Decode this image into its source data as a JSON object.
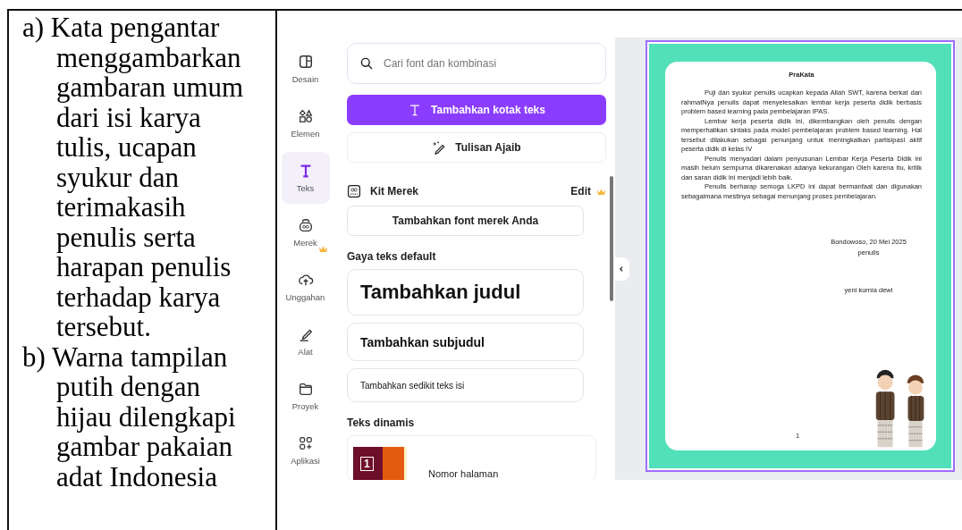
{
  "description_cell": {
    "items": [
      {
        "marker": "a)",
        "text": "Kata pengantar menggambarkan gambaran umum dari isi karya tulis, ucapan syukur dan terimakasih penulis serta harapan penulis terhadap karya tersebut."
      },
      {
        "marker": "b)",
        "text": "Warna tampilan putih dengan hijau dilengkapi gambar pakaian adat Indonesia"
      }
    ]
  },
  "canva": {
    "rail": [
      {
        "kind": "design",
        "label": "Desain",
        "selected": false,
        "premium": false
      },
      {
        "kind": "elements",
        "label": "Elemen",
        "selected": false,
        "premium": false
      },
      {
        "kind": "text",
        "label": "Teks",
        "selected": true,
        "premium": false
      },
      {
        "kind": "brand",
        "label": "Merek",
        "selected": false,
        "premium": true
      },
      {
        "kind": "upload",
        "label": "Unggahan",
        "selected": false,
        "premium": false
      },
      {
        "kind": "tools",
        "label": "Alat",
        "selected": false,
        "premium": false
      },
      {
        "kind": "projects",
        "label": "Proyek",
        "selected": false,
        "premium": false
      },
      {
        "kind": "apps",
        "label": "Aplikasi",
        "selected": false,
        "premium": false
      }
    ],
    "panel": {
      "search": {
        "placeholder": "Cari font dan kombinasi"
      },
      "add_text_button": "Tambahkan kotak teks",
      "magic_write_button": "Tulisan Ajaib",
      "brand_kit": {
        "title": "Kit Merek",
        "edit": "Edit",
        "edit_premium": true,
        "add_font_button": "Tambahkan font merek Anda"
      },
      "default_styles_heading": "Gaya teks default",
      "styles": [
        {
          "kind": "heading",
          "label": "Tambahkan judul"
        },
        {
          "kind": "subheading",
          "label": "Tambahkan subjudul"
        },
        {
          "kind": "body",
          "label": "Tambahkan sedikit teks isi"
        }
      ],
      "dynamic_heading": "Teks dinamis",
      "dynamic_item": {
        "thumb_number": "1",
        "label": "Nomor halaman"
      }
    },
    "page": {
      "title": "PraKata",
      "paragraphs": [
        "Puji dan syukur penulis ucapkan kepada Allah SWT, karena berkat dan rahmatNya penulis dapat menyelesaikan lembar kerja peserta didik berbasis problem based learning pada pembelajaran IPAS.",
        "Lembar kerja peserta didik ini, dikembangkan oleh penulis dengan memperhatikan sintaks pada model pembelajaran problem based learning. Hal tersebut dilakukan sebagai penunjang untuk meningkatkan partisipasi aktif peserta didik di kelas IV",
        "Penulis menyadari dalam penyusunan Lembar Kerja Peserta Didik ini masih belum sempurna dikarenakan adanya kekurangan Oleh karena itu, kritik dan saran didik ini menjadi lebih baik.",
        "Penulis berharap semoga LKPD ini dapat bermanfaat dan digunakan sebagaimana mestinya sebagai menunjang proses pembelajaran."
      ],
      "place_date": "Bondowoso, 20 Mei 2025",
      "role": "penulis",
      "name": "yeni kurnia dewi",
      "page_number": "1"
    }
  }
}
